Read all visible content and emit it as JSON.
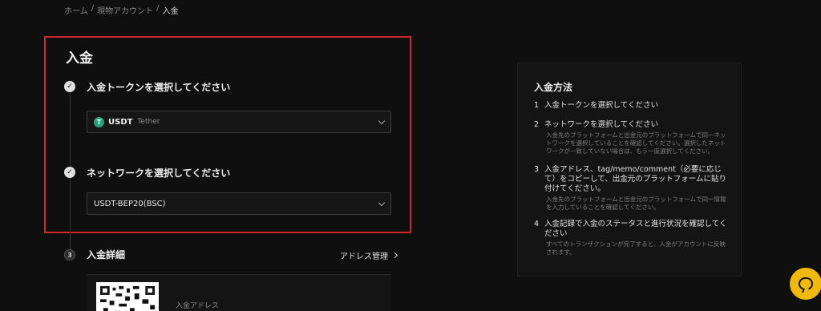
{
  "breadcrumb": {
    "home": "ホーム",
    "sep1": "/",
    "account": "現物アカウント",
    "sep2": "/",
    "current": "入金"
  },
  "deposit": {
    "title": "入金",
    "step1": {
      "icon": "check-icon",
      "label": "入金トークンを選択してください",
      "selected_symbol": "USDT",
      "selected_name": "Tether",
      "token_icon_glyph": "T"
    },
    "step2": {
      "icon": "check-icon",
      "label": "ネットワークを選択してください",
      "selected_network": "USDT-BEP20(BSC)"
    },
    "step3": {
      "number": "3",
      "label": "入金詳細",
      "address_manage": "アドレス管理",
      "address_label": "入金アドレス"
    }
  },
  "how_to": {
    "title": "入金方法",
    "steps": [
      {
        "n": "1",
        "title": "入金トークンを選択してください",
        "desc": ""
      },
      {
        "n": "2",
        "title": "ネットワークを選択してください",
        "desc": "入金先のプラットフォームと出金元のプラットフォームで同一ネットワークを選択していることを確認してください。選択したネットワークが一致していない場合は、もう一度選択してください。"
      },
      {
        "n": "3",
        "title": "入金アドレス、tag/memo/comment（必要に応じて）をコピーして、出金元のプラットフォームに貼り付けてください。",
        "desc": "入金先のプラットフォームと出金元のプラットフォームで同一情報を入力していることを確認してください。"
      },
      {
        "n": "4",
        "title": "入金記録で入金のステータスと進行状況を確認してください",
        "desc": "すべてのトランザクションが完了すると、入金がアカウントに反映されます。"
      }
    ]
  },
  "colors": {
    "highlight": "#d0262e",
    "accent": "#f0b90b",
    "tether": "#26a17b"
  }
}
